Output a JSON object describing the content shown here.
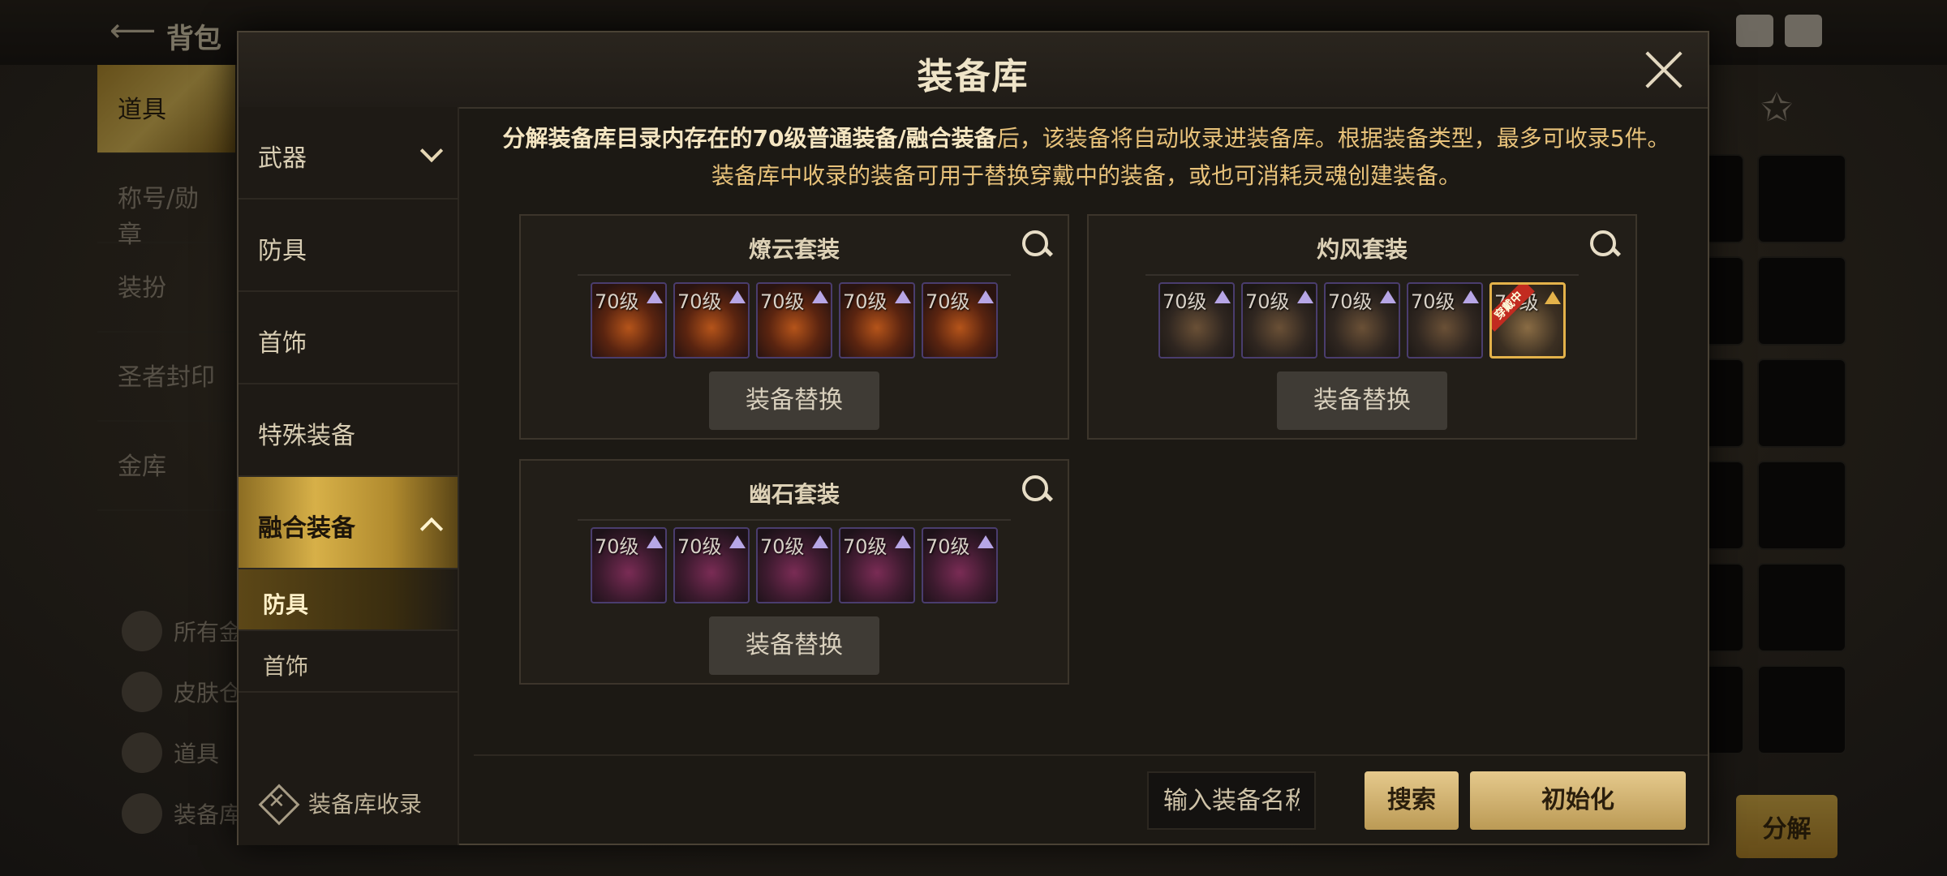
{
  "background": {
    "back_label": "背包",
    "nav_items": [
      "道具",
      "称号/勋章",
      "装扮",
      "圣者封印",
      "金库"
    ],
    "bottom_items": [
      "所有金",
      "皮肤仓",
      "道具",
      "装备库"
    ],
    "decompose_label": "分解"
  },
  "modal": {
    "title": "装备库",
    "description_highlight": "分解装备库目录内存在的70级普通装备/融合装备",
    "description_rest": "后，该装备将自动收录进装备库。根据装备类型，最多可收录5件。",
    "description_line2": "装备库中收录的装备可用于替换穿戴中的装备，或也可消耗灵魂创建装备。"
  },
  "categories": [
    {
      "label": "武器",
      "state": "collapsed"
    },
    {
      "label": "防具"
    },
    {
      "label": "首饰"
    },
    {
      "label": "特殊装备"
    },
    {
      "label": "融合装备",
      "state": "expanded"
    }
  ],
  "subcategories": [
    {
      "label": "防具",
      "selected": true
    },
    {
      "label": "首饰",
      "selected": false
    }
  ],
  "collect_link": "装备库收录",
  "sets": [
    {
      "name": "燎云套装",
      "swap_label": "装备替换",
      "items": [
        "70级",
        "70级",
        "70级",
        "70级",
        "70级"
      ]
    },
    {
      "name": "灼风套装",
      "swap_label": "装备替换",
      "items": [
        "70级",
        "70级",
        "70级",
        "70级",
        "70级"
      ],
      "equipped_badge": "穿戴中"
    },
    {
      "name": "幽石套装",
      "swap_label": "装备替换",
      "items": [
        "70级",
        "70级",
        "70级",
        "70级",
        "70级"
      ]
    }
  ],
  "footer": {
    "search_placeholder": "输入装备名称",
    "search_button": "搜索",
    "reset_button": "初始化"
  },
  "colors": {
    "accent_gold": "#d7b048",
    "button_gold": "#e5c98c",
    "highlight_text": "#e8c27a"
  }
}
